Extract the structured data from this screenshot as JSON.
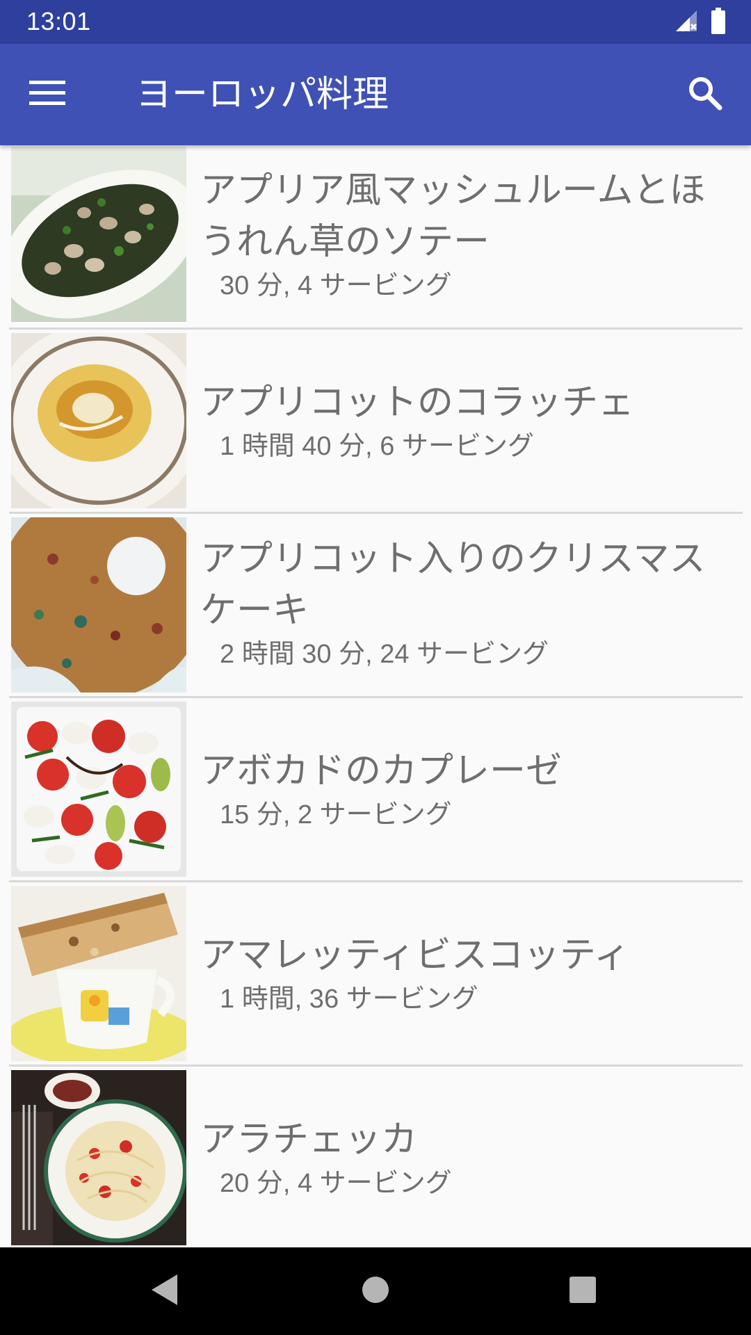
{
  "status_bar": {
    "time": "13:01",
    "icons": [
      "cell-signal-no-data-icon",
      "battery-full-icon"
    ]
  },
  "app_bar": {
    "title": "ヨーロッパ料理",
    "icons": [
      "menu-icon",
      "search-icon"
    ]
  },
  "recipes": [
    {
      "name": "アプリア風マッシュルームとほうれん草のソテー",
      "meta": "30 分, 4 サービング",
      "thumbnail": "mushroom-spinach-saute-photo"
    },
    {
      "name": "アプリコットのコラッチェ",
      "meta": "1 時間 40 分, 6 サービング",
      "thumbnail": "apricot-kolache-photo"
    },
    {
      "name": "アプリコット入りのクリスマスケーキ",
      "meta": "2 時間 30 分, 24 サービング",
      "thumbnail": "christmas-cake-photo"
    },
    {
      "name": "アボカドのカプレーゼ",
      "meta": "15 分, 2 サービング",
      "thumbnail": "avocado-caprese-photo"
    },
    {
      "name": "アマレッティビスコッティ",
      "meta": "1 時間, 36 サービング",
      "thumbnail": "amaretti-biscotti-photo"
    },
    {
      "name": "アラチェッカ",
      "meta": "20 分, 4 サービング",
      "thumbnail": "pasta-checca-photo"
    }
  ],
  "nav_bar": {
    "icons": [
      "back-icon",
      "home-icon",
      "recents-icon"
    ]
  },
  "colors": {
    "status_bar": "#2f3f9e",
    "app_bar": "#3f51b5",
    "list_background": "#fafafa",
    "text": "#6e6e6e",
    "divider": "#d8d8d8"
  }
}
